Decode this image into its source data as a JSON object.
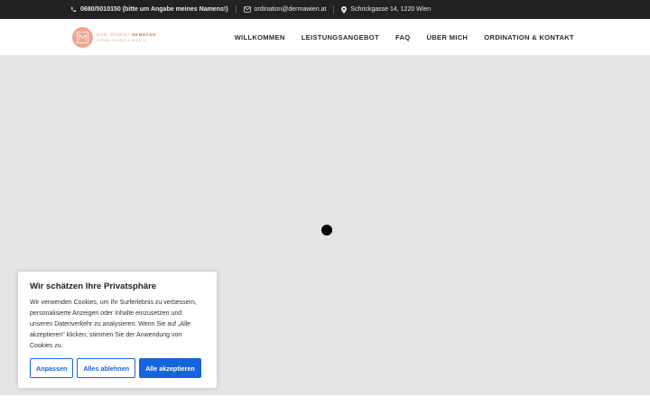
{
  "topbar": {
    "phone": "0680/5010150 (bitte um Angabe meines Namens!)",
    "email": "ordination@dermawien.at",
    "address": "Schrickgasse 14, 1220 Wien"
  },
  "logo": {
    "name_prefix": "DDR. ROMINA ",
    "name_highlight": "NEMECEK",
    "subtitle": "DERMATOLOGIE & WIEN 22"
  },
  "nav": {
    "items": [
      "WILLKOMMEN",
      "LEISTUNGSANGEBOT",
      "FAQ",
      "ÜBER MICH",
      "ORDINATION & KONTAKT"
    ]
  },
  "cookie": {
    "title": "Wir schätzen Ihre Privatsphäre",
    "text": "Wir verwenden Cookies, um Ihr Surferlebnis zu verbessern, personalisierte Anzeigen oder Inhalte einzusetzen und unseren Datenverkehr zu analysieren. Wenn Sie auf „Alle akzeptieren\" klicken, stimmen Sie der Anwendung von Cookies zu.",
    "customize_label": "Anpassen",
    "reject_label": "Alles ablehnen",
    "accept_label": "Alle akzeptieren"
  },
  "colors": {
    "topbar_bg": "#222222",
    "brand_coral": "#f1a493",
    "accent_blue": "#1863dc",
    "content_bg": "#e5e5e5"
  },
  "icons": [
    "phone-icon",
    "envelope-icon",
    "map-pin-icon",
    "logo-monogram-icon"
  ]
}
